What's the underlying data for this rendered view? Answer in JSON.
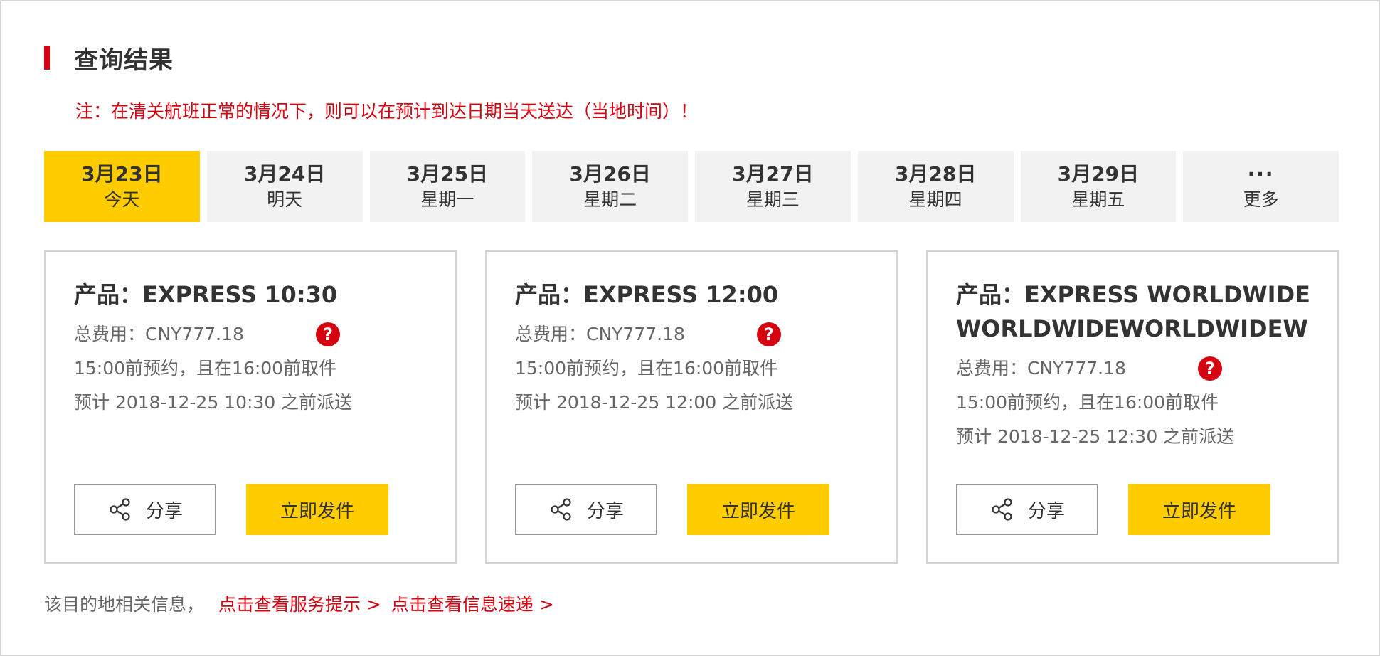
{
  "colors": {
    "brand_red": "#d40511",
    "brand_yellow": "#ffcc00",
    "tab_bg": "#f2f2f2"
  },
  "header": {
    "title": "查询结果",
    "notice": "注：在清关航班正常的情况下，则可以在预计到达日期当天送达（当地时间）！"
  },
  "date_tabs": [
    {
      "date": "3月23日",
      "day": "今天",
      "active": true
    },
    {
      "date": "3月24日",
      "day": "明天",
      "active": false
    },
    {
      "date": "3月25日",
      "day": "星期一",
      "active": false
    },
    {
      "date": "3月26日",
      "day": "星期二",
      "active": false
    },
    {
      "date": "3月27日",
      "day": "星期三",
      "active": false
    },
    {
      "date": "3月28日",
      "day": "星期四",
      "active": false
    },
    {
      "date": "3月29日",
      "day": "星期五",
      "active": false
    }
  ],
  "more_tab": {
    "dots": "···",
    "label": "更多"
  },
  "cards": [
    {
      "title": "产品：EXPRESS 10:30",
      "fee": "总费用：CNY777.18",
      "booking": "15:00前预约，且在16:00前取件",
      "delivery": "预计 2018-12-25  10:30  之前派送"
    },
    {
      "title": "产品：EXPRESS 12:00",
      "fee": "总费用：CNY777.18",
      "booking": "15:00前预约，且在16:00前取件",
      "delivery": "预计 2018-12-25  12:00  之前派送"
    },
    {
      "title": "产品：EXPRESS WORLDWIDE WORLDWIDEWORLDWIDEW",
      "fee": "总费用：CNY777.18",
      "booking": "15:00前预约，且在16:00前取件",
      "delivery": "预计 2018-12-25  12:30  之前派送"
    }
  ],
  "help_icon": {
    "icon": "help-icon",
    "glyph": "?"
  },
  "buttons": {
    "share": "分享",
    "share_icon": "share-icon",
    "ship": "立即发件"
  },
  "footer": {
    "label": "该目的地相关信息，",
    "link_service": "点击查看服务提示 >",
    "link_info": "点击查看信息速递 >"
  }
}
